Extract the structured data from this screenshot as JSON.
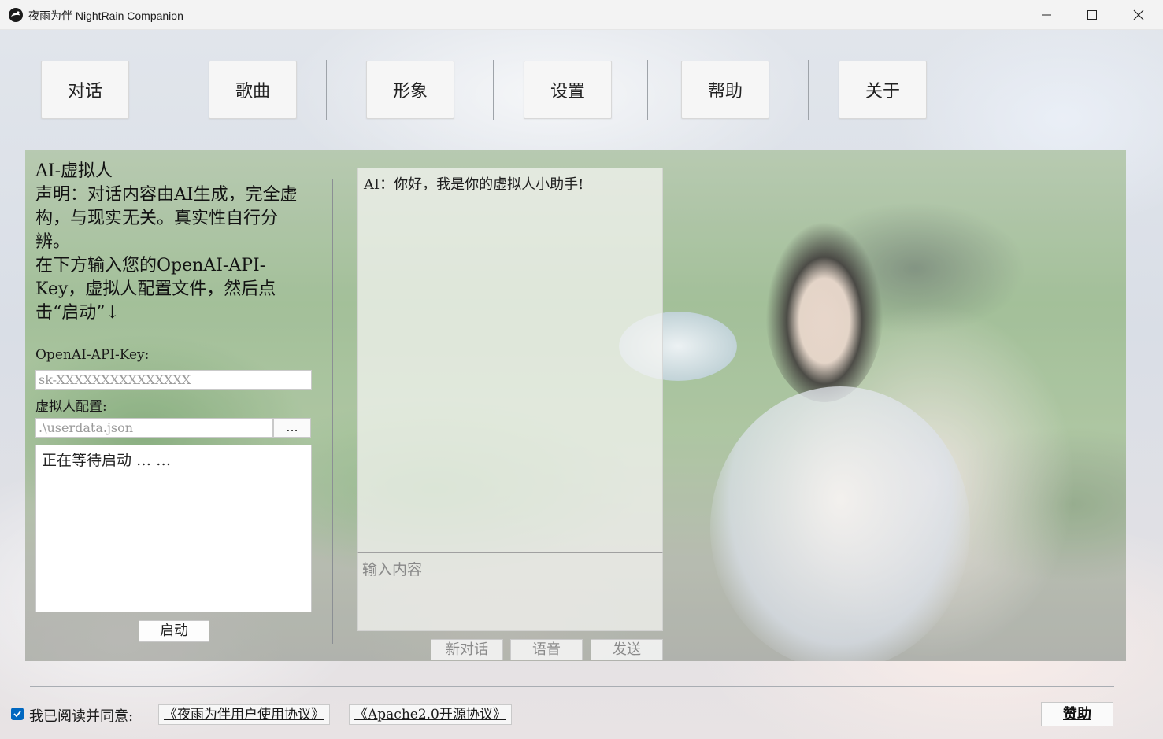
{
  "window": {
    "title": "夜雨为伴 NightRain Companion",
    "accent_color": "#0067c0"
  },
  "nav": {
    "items": [
      {
        "label": "对话"
      },
      {
        "label": "歌曲"
      },
      {
        "label": "形象"
      },
      {
        "label": "设置"
      },
      {
        "label": "帮助"
      },
      {
        "label": "关于"
      }
    ]
  },
  "left_panel": {
    "title": "AI-虚拟人",
    "disclaimer": "声明：对话内容由AI生成，完全虚构，与现实无关。真实性自行分辨。",
    "instruction": "在下方输入您的OpenAI-API-Key，虚拟人配置文件，然后点击“启动”↓",
    "api_key_label": "OpenAI-API-Key:",
    "api_key_placeholder": "sk-XXXXXXXXXXXXXXX",
    "config_label": "虚拟人配置:",
    "config_placeholder": ".\\userdata.json",
    "browse_label": "...",
    "status_text": "正在等待启动 … …",
    "start_label": "启动"
  },
  "chat": {
    "greeting": "AI：你好，我是你的虚拟人小助手!",
    "input_placeholder": "输入内容",
    "buttons": {
      "new_chat": "新对话",
      "voice": "语音",
      "send": "发送"
    }
  },
  "footer": {
    "agree_checked": true,
    "agree_label": "我已阅读并同意:",
    "user_agreement": "《夜雨为伴用户使用协议》",
    "license": "《Apache2.0开源协议》",
    "sponsor_label": "赞助"
  }
}
